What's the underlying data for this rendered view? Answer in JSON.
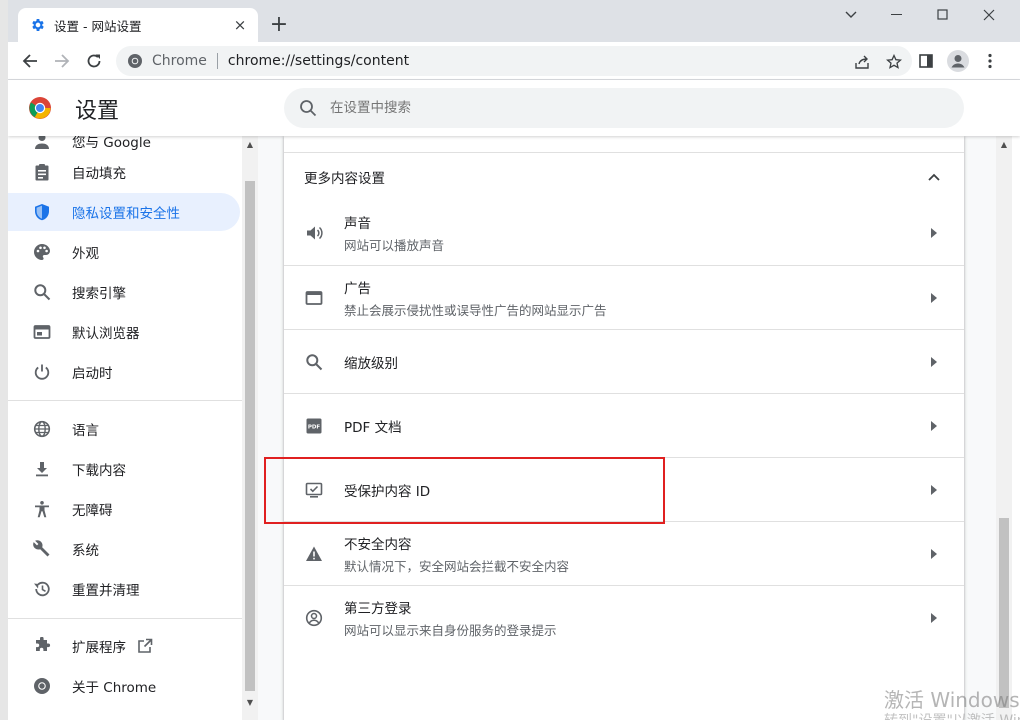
{
  "tab": {
    "title": "设置 - 网站设置",
    "close_label": "×"
  },
  "newtab_label": "+",
  "omnibox": {
    "chip": "Chrome",
    "url": "chrome://settings/content"
  },
  "settings": {
    "title": "设置",
    "search_placeholder": "在设置中搜索"
  },
  "sidebar": {
    "items": [
      {
        "label": "您与 Google",
        "icon": "person-icon"
      },
      {
        "label": "自动填充",
        "icon": "clipboard-icon"
      },
      {
        "label": "隐私设置和安全性",
        "icon": "shield-icon",
        "active": true
      },
      {
        "label": "外观",
        "icon": "palette-icon"
      },
      {
        "label": "搜索引擎",
        "icon": "search-icon"
      },
      {
        "label": "默认浏览器",
        "icon": "browser-window-icon"
      },
      {
        "label": "启动时",
        "icon": "power-icon"
      },
      {
        "label": "语言",
        "icon": "globe-icon"
      },
      {
        "label": "下载内容",
        "icon": "download-icon"
      },
      {
        "label": "无障碍",
        "icon": "accessibility-icon"
      },
      {
        "label": "系统",
        "icon": "wrench-icon"
      },
      {
        "label": "重置并清理",
        "icon": "history-icon"
      },
      {
        "label": "扩展程序",
        "icon": "puzzle-icon"
      },
      {
        "label": "关于 Chrome",
        "icon": "chrome-logo-icon"
      }
    ]
  },
  "main": {
    "section_title": "更多内容设置",
    "rows": [
      {
        "title": "声音",
        "subtitle": "网站可以播放声音",
        "icon": "speaker-icon"
      },
      {
        "title": "广告",
        "subtitle": "禁止会展示侵扰性或误导性广告的网站显示广告",
        "icon": "ad-window-icon"
      },
      {
        "title": "缩放级别",
        "subtitle": "",
        "icon": "zoom-icon"
      },
      {
        "title": "PDF 文档",
        "subtitle": "",
        "icon": "pdf-icon"
      },
      {
        "title": "受保护内容 ID",
        "subtitle": "",
        "icon": "protected-content-icon"
      },
      {
        "title": "不安全内容",
        "subtitle": "默认情况下，安全网站会拦截不安全内容",
        "icon": "warning-icon"
      },
      {
        "title": "第三方登录",
        "subtitle": "网站可以显示来自身份服务的登录提示",
        "icon": "account-circle-icon"
      }
    ]
  },
  "watermark": {
    "line1": "激活 Windows",
    "line2": "转到\"设置\"以激活 Windows。"
  },
  "colors": {
    "accent": "#1a73e8",
    "active_bg": "#e8f0fe",
    "highlight": "#e02020"
  }
}
